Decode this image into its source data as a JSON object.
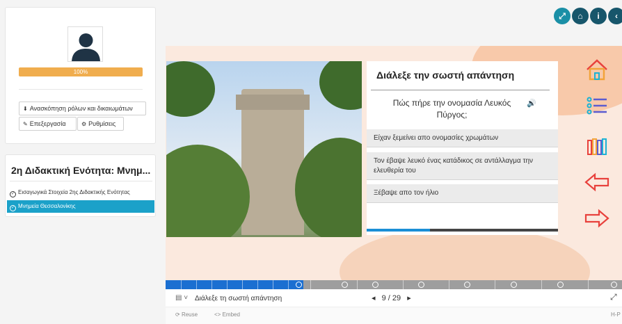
{
  "profile": {
    "progress_percent": 100,
    "progress_label": "100%",
    "buttons": {
      "overview": "Ανασκόπηση ρόλων και δικαιωμάτων",
      "edit": "Επεξεργασία",
      "settings": "Ρυθμίσεις"
    }
  },
  "unit": {
    "title": "2η Διδακτική Ενότητα: Μνημ...",
    "items": [
      {
        "label": "Εισαγωγικά Στοιχεία 2ης Διδακτικής Ενότητας"
      },
      {
        "label": "Μνημεία Θεσσαλονίκης"
      }
    ]
  },
  "top_buttons": {
    "expand": "⤢",
    "home": "⌂",
    "info": "i",
    "back": "‹"
  },
  "question": {
    "title": "Διάλεξε την σωστή απάντηση",
    "text": "Πώς πήρε την ονομασία Λευκός Πύργος;",
    "audio_icon": "🔊",
    "answers": [
      "Είχαν ξεμείνει απο ονομασίες χρωμάτων",
      "Τον έβαψε λευκό ένας κατάδικος σε αντάλλαγμα την ελευθερία του",
      "Ξέβαψε απο τον ήλιο"
    ],
    "progress_fraction": 0.33
  },
  "footer": {
    "slide_title": "Διάλεξε τη σωστή απάντηση",
    "page": "9 / 29",
    "prev": "◂",
    "next": "▸",
    "reuse": "Reuse",
    "embed": "Embed",
    "h5p": "H-P"
  },
  "timeline": {
    "progress_fraction": 0.302
  },
  "colors": {
    "accent": "#1ba1c9",
    "progress": "#f0ad4e",
    "timeline_fill": "#1b6fd1",
    "nav_icons": "#e8413c"
  }
}
